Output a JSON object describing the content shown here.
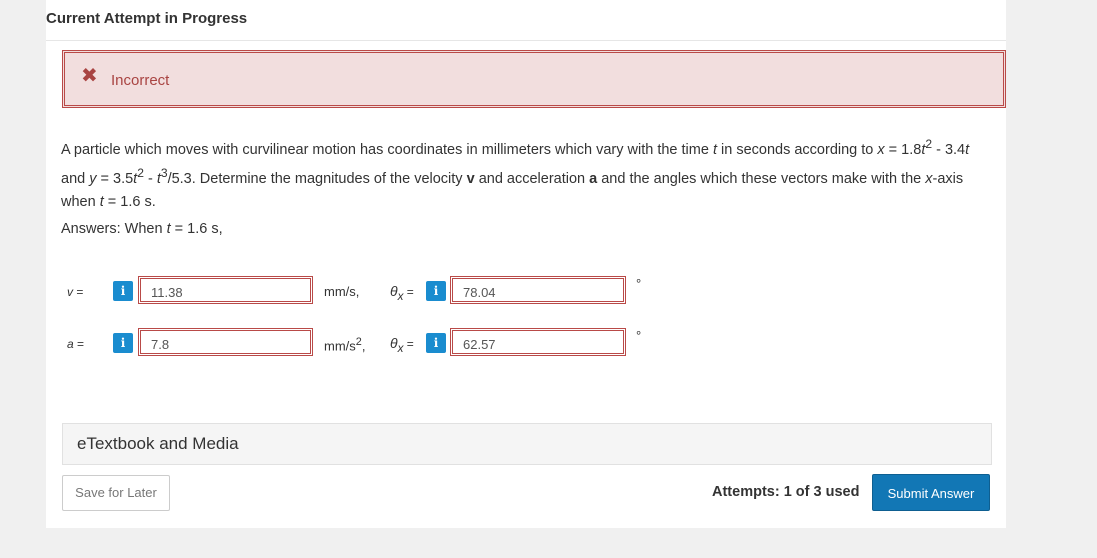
{
  "header": {
    "title": "Current Attempt in Progress"
  },
  "alert": {
    "icon": "close-icon",
    "text": "Incorrect"
  },
  "question": {
    "part1": "A particle which moves with curvilinear motion has coordinates in millimeters which vary with the time ",
    "t1": "t",
    "part2": " in seconds according to ",
    "x1": "x",
    "part3": " = 1.8",
    "t2": "t",
    "sup2a": "2",
    "part4": " - 3.4",
    "t3": "t",
    "part5": " and ",
    "y1": "y",
    "part6": " = 3.5",
    "t4": "t",
    "sup2b": "2",
    "part7": " - ",
    "t5": "t",
    "sup3": "3",
    "part8": "/5.3. Determine the magnitudes of the velocity ",
    "v_bold": "v",
    "part9": " and acceleration ",
    "a_bold": "a",
    "part10": " and the angles which these vectors make with the ",
    "x2": "x",
    "part11": "-axis when ",
    "t6": "t",
    "part12": " = 1.6 s."
  },
  "answers": {
    "label_prefix": "Answers: When ",
    "label_t": "t",
    "label_suffix": " = 1.6 s,",
    "rows": [
      {
        "var": "v",
        "eq": " =",
        "value": "11.38",
        "unit": "mm/s,",
        "theta": "θ",
        "theta_sub": "x",
        "theta_eq": " =",
        "angle": "78.04",
        "degree": "°"
      },
      {
        "var": "a",
        "eq": " =",
        "value": "7.8",
        "unit_base": "mm/s",
        "unit_sup": "2",
        "unit_comma": ",",
        "theta": "θ",
        "theta_sub": "x",
        "theta_eq": " =",
        "angle": "62.57",
        "degree": "°"
      }
    ],
    "info_glyph": "i"
  },
  "etextbook": {
    "label": "eTextbook and Media"
  },
  "footer": {
    "save_label": "Save for Later",
    "attempts": "Attempts: 1 of 3 used",
    "submit_label": "Submit Answer"
  },
  "colors": {
    "error_bg": "#f2dede",
    "error_border": "#b94a48",
    "info_blue": "#1a8ccf",
    "submit_blue": "#1277b5"
  }
}
